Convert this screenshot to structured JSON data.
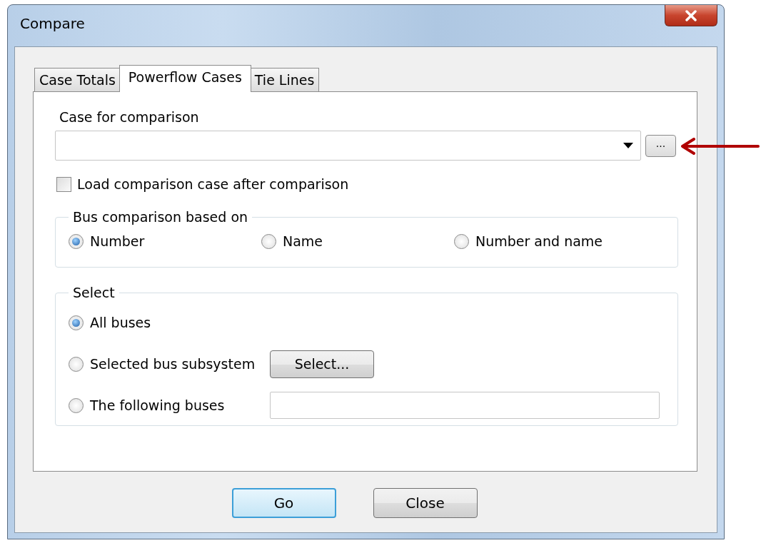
{
  "window": {
    "title": "Compare"
  },
  "tabs": [
    {
      "label": "Case Totals",
      "selected": false
    },
    {
      "label": "Powerflow Cases",
      "selected": true
    },
    {
      "label": "Tie Lines",
      "selected": false
    }
  ],
  "case_field": {
    "label": "Case for comparison",
    "browse_button": "..."
  },
  "load_checkbox": {
    "label": "Load comparison case after comparison",
    "checked": false
  },
  "bus_comparison": {
    "title": "Bus comparison based on",
    "options": [
      {
        "label": "Number",
        "selected": true
      },
      {
        "label": "Name",
        "selected": false
      },
      {
        "label": "Number and name",
        "selected": false
      }
    ]
  },
  "select_group": {
    "title": "Select",
    "options": [
      {
        "label": "All buses",
        "selected": true,
        "kind": "plain"
      },
      {
        "label": "Selected bus subsystem",
        "selected": false,
        "kind": "button",
        "button": "Select..."
      },
      {
        "label": "The following buses",
        "selected": false,
        "kind": "field"
      }
    ]
  },
  "buttons": [
    {
      "label": "Go",
      "default": true
    },
    {
      "label": "Close",
      "default": false
    }
  ]
}
